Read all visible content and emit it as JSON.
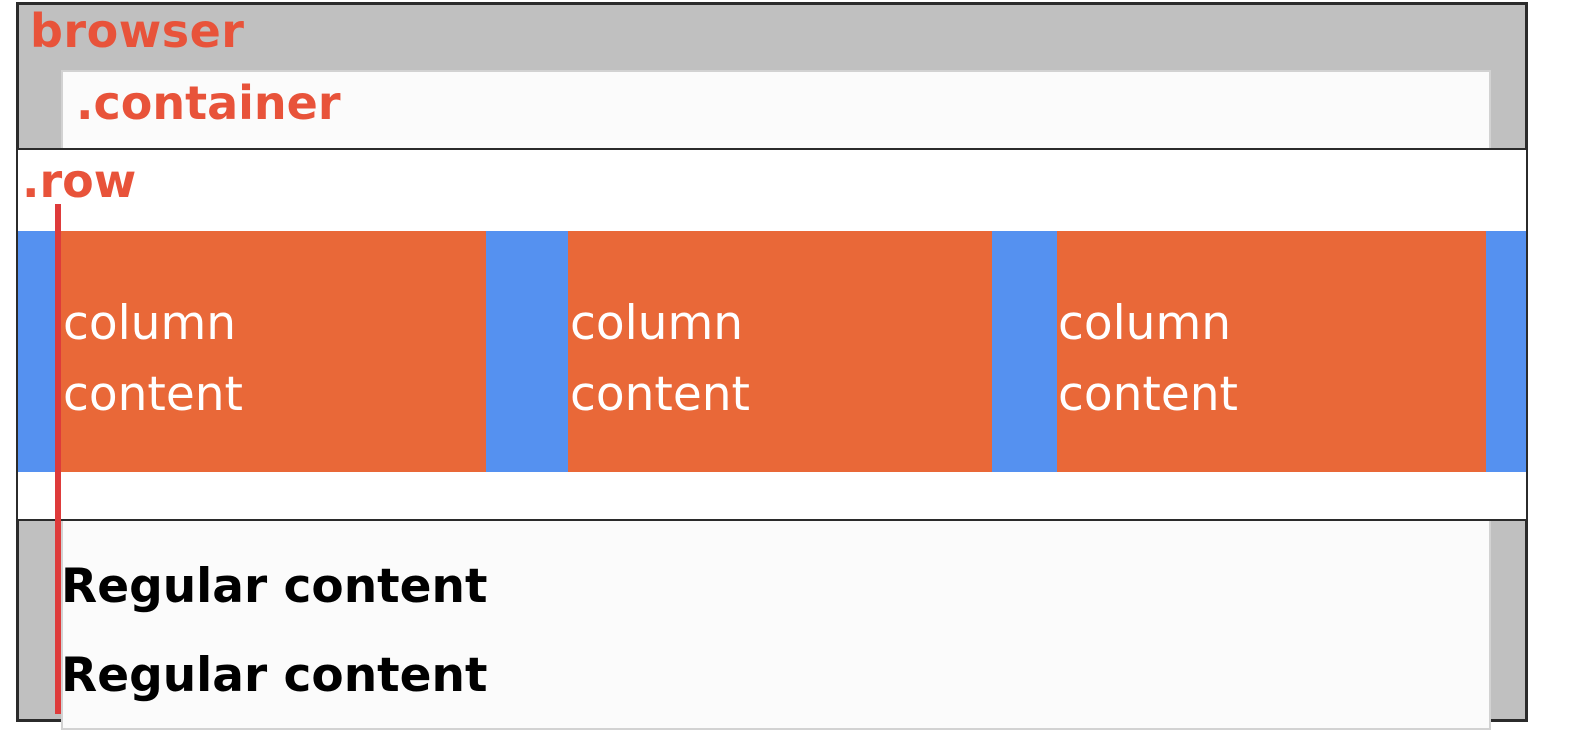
{
  "labels": {
    "browser": "browser",
    "container": ".container",
    "row": ".row"
  },
  "columns": [
    {
      "line1": "column",
      "line2": "content"
    },
    {
      "line1": "column",
      "line2": "content"
    },
    {
      "line1": "column",
      "line2": "content"
    }
  ],
  "regular_content": [
    "Regular content",
    "Regular content"
  ],
  "colors": {
    "label_red": "#e8533a",
    "column_orange": "#e96838",
    "gutter_blue": "#5591f0",
    "browser_gray": "#c0c0c0",
    "container_bg": "#fbfbfb",
    "marker_line": "#de3b3b"
  }
}
